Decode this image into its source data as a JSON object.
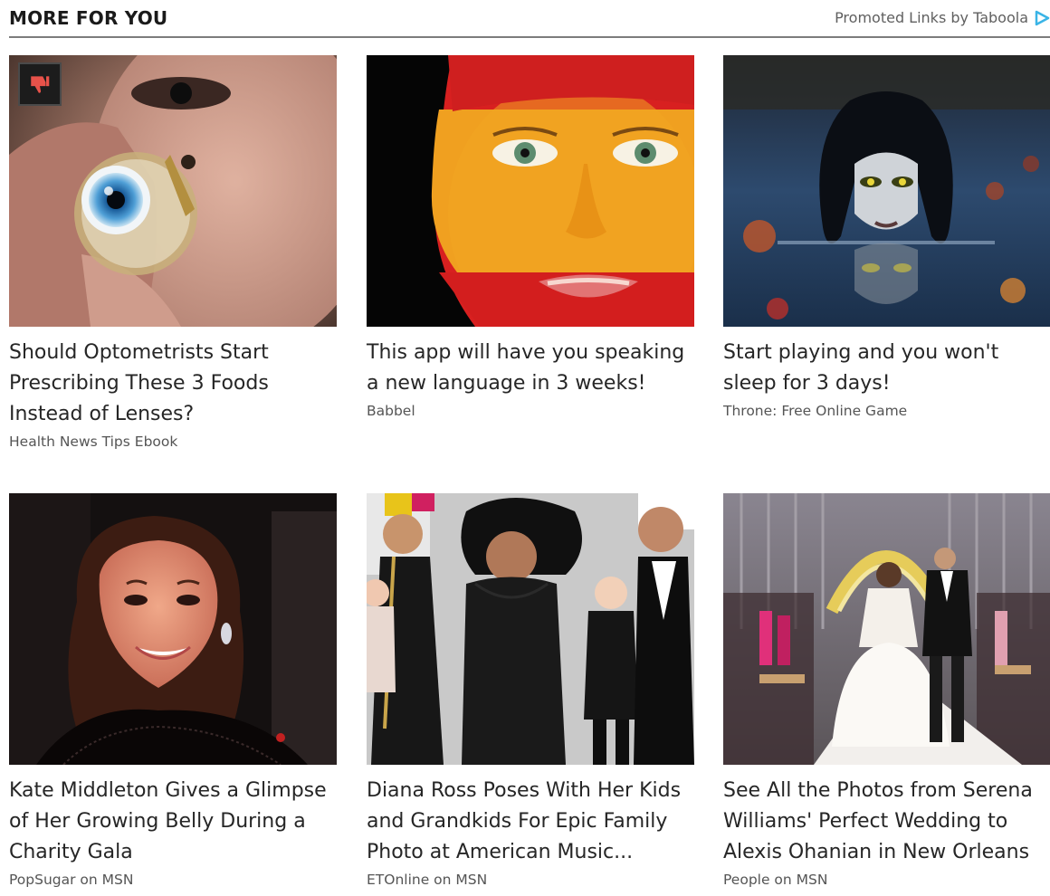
{
  "header": {
    "title": "MORE FOR YOU",
    "promo_label": "Promoted Links by Taboola",
    "promo_icon": "taboola-play-icon",
    "accent_color": "#3ab4e6"
  },
  "cards": [
    {
      "title": "Should Optometrists Start Prescribing These 3 Foods Instead of Lenses?",
      "source": "Health News Tips Ebook",
      "image": "eye-implant-photo"
    },
    {
      "title": "This app will have you speaking a new language in 3 weeks!",
      "source": "Babbel",
      "image": "spanish-flag-face-photo"
    },
    {
      "title": "Start playing and you won't sleep for 3 days!",
      "source": "Throne: Free Online Game",
      "image": "dark-witch-water-photo"
    },
    {
      "title": "Kate Middleton Gives a Glimpse of Her Growing Belly During a Charity Gala",
      "source": "PopSugar on MSN",
      "image": "kate-middleton-photo"
    },
    {
      "title": "Diana Ross Poses With Her Kids and Grandkids For Epic Family Photo at American Music...",
      "source": "ETOnline on MSN",
      "image": "diana-ross-family-photo"
    },
    {
      "title": "See All the Photos from Serena Williams' Perfect Wedding to Alexis Ohanian in New Orleans",
      "source": "People on MSN",
      "image": "serena-wedding-photo"
    }
  ],
  "dislike_icon": "thumbs-down-icon",
  "dislike_color": "#e8524a"
}
